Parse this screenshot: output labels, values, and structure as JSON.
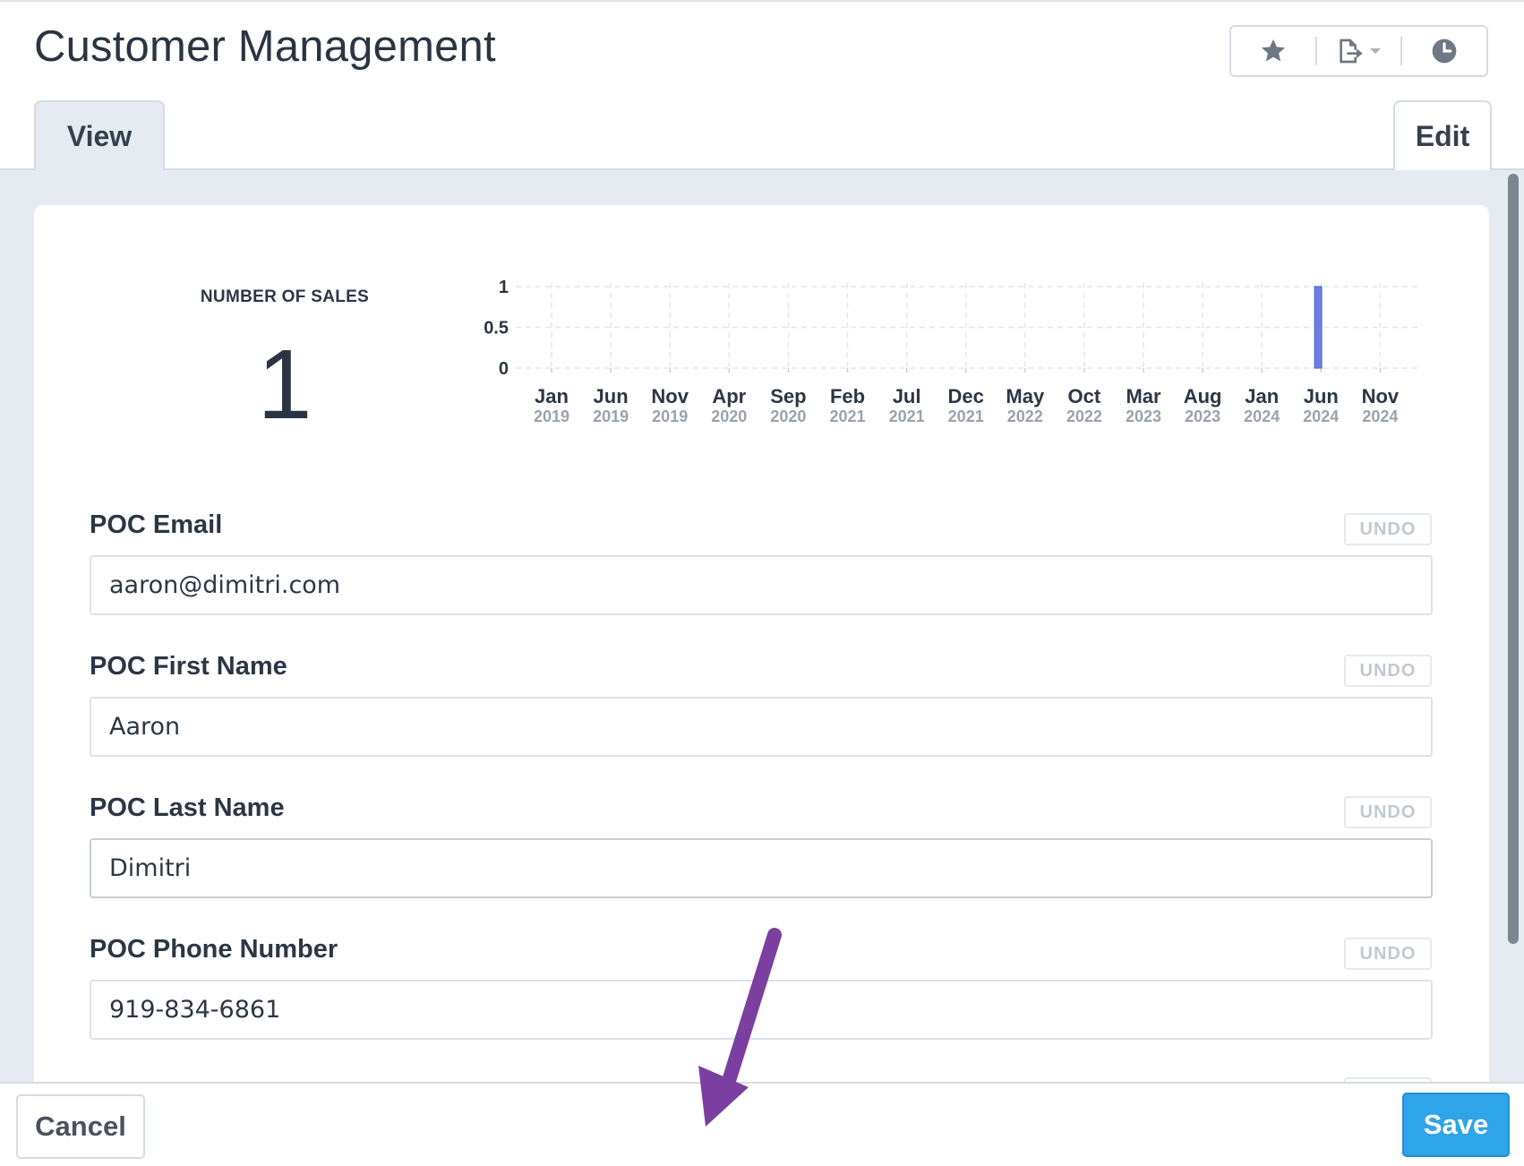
{
  "header": {
    "title": "Customer Management",
    "actions": [
      {
        "icon": "star-icon"
      },
      {
        "icon": "export-icon"
      },
      {
        "icon": "history-icon"
      }
    ]
  },
  "tabs": {
    "view_label": "View",
    "edit_label": "Edit"
  },
  "metric": {
    "label": "NUMBER OF SALES",
    "value": "1"
  },
  "chart_data": {
    "type": "bar",
    "x": [
      "Jan 2019",
      "Jun 2019",
      "Nov 2019",
      "Apr 2020",
      "Sep 2020",
      "Feb 2021",
      "Jul 2021",
      "Dec 2021",
      "May 2022",
      "Oct 2022",
      "Mar 2023",
      "Aug 2023",
      "Jan 2024",
      "Jun 2024",
      "Nov 2024"
    ],
    "tick_months": [
      "Jan",
      "Jun",
      "Nov",
      "Apr",
      "Sep",
      "Feb",
      "Jul",
      "Dec",
      "May",
      "Oct",
      "Mar",
      "Aug",
      "Jan",
      "Jun",
      "Nov"
    ],
    "tick_years": [
      "2019",
      "2019",
      "2019",
      "2020",
      "2020",
      "2021",
      "2021",
      "2021",
      "2022",
      "2022",
      "2023",
      "2023",
      "2024",
      "2024",
      "2024"
    ],
    "bars": [
      {
        "date": "May 2024",
        "value": 1
      }
    ],
    "yticks": [
      "1",
      "0.5",
      "0"
    ],
    "ylim": [
      0,
      1
    ],
    "grid": true,
    "bar_color": "#6b7fe0",
    "xlabel": "",
    "ylabel": ""
  },
  "fields": [
    {
      "label": "POC Email",
      "value": "aaron@dimitri.com",
      "undo": "UNDO"
    },
    {
      "label": "POC First Name",
      "value": "Aaron",
      "undo": "UNDO"
    },
    {
      "label": "POC Last Name",
      "value": "Dimitri",
      "undo": "UNDO"
    },
    {
      "label": "POC Phone Number",
      "value": "919-834-6861",
      "undo": "UNDO"
    }
  ],
  "footer": {
    "cancel_label": "Cancel",
    "save_label": "Save"
  },
  "colors": {
    "accent": "#2fa4e8",
    "annotation_arrow": "#7b3fa0"
  }
}
